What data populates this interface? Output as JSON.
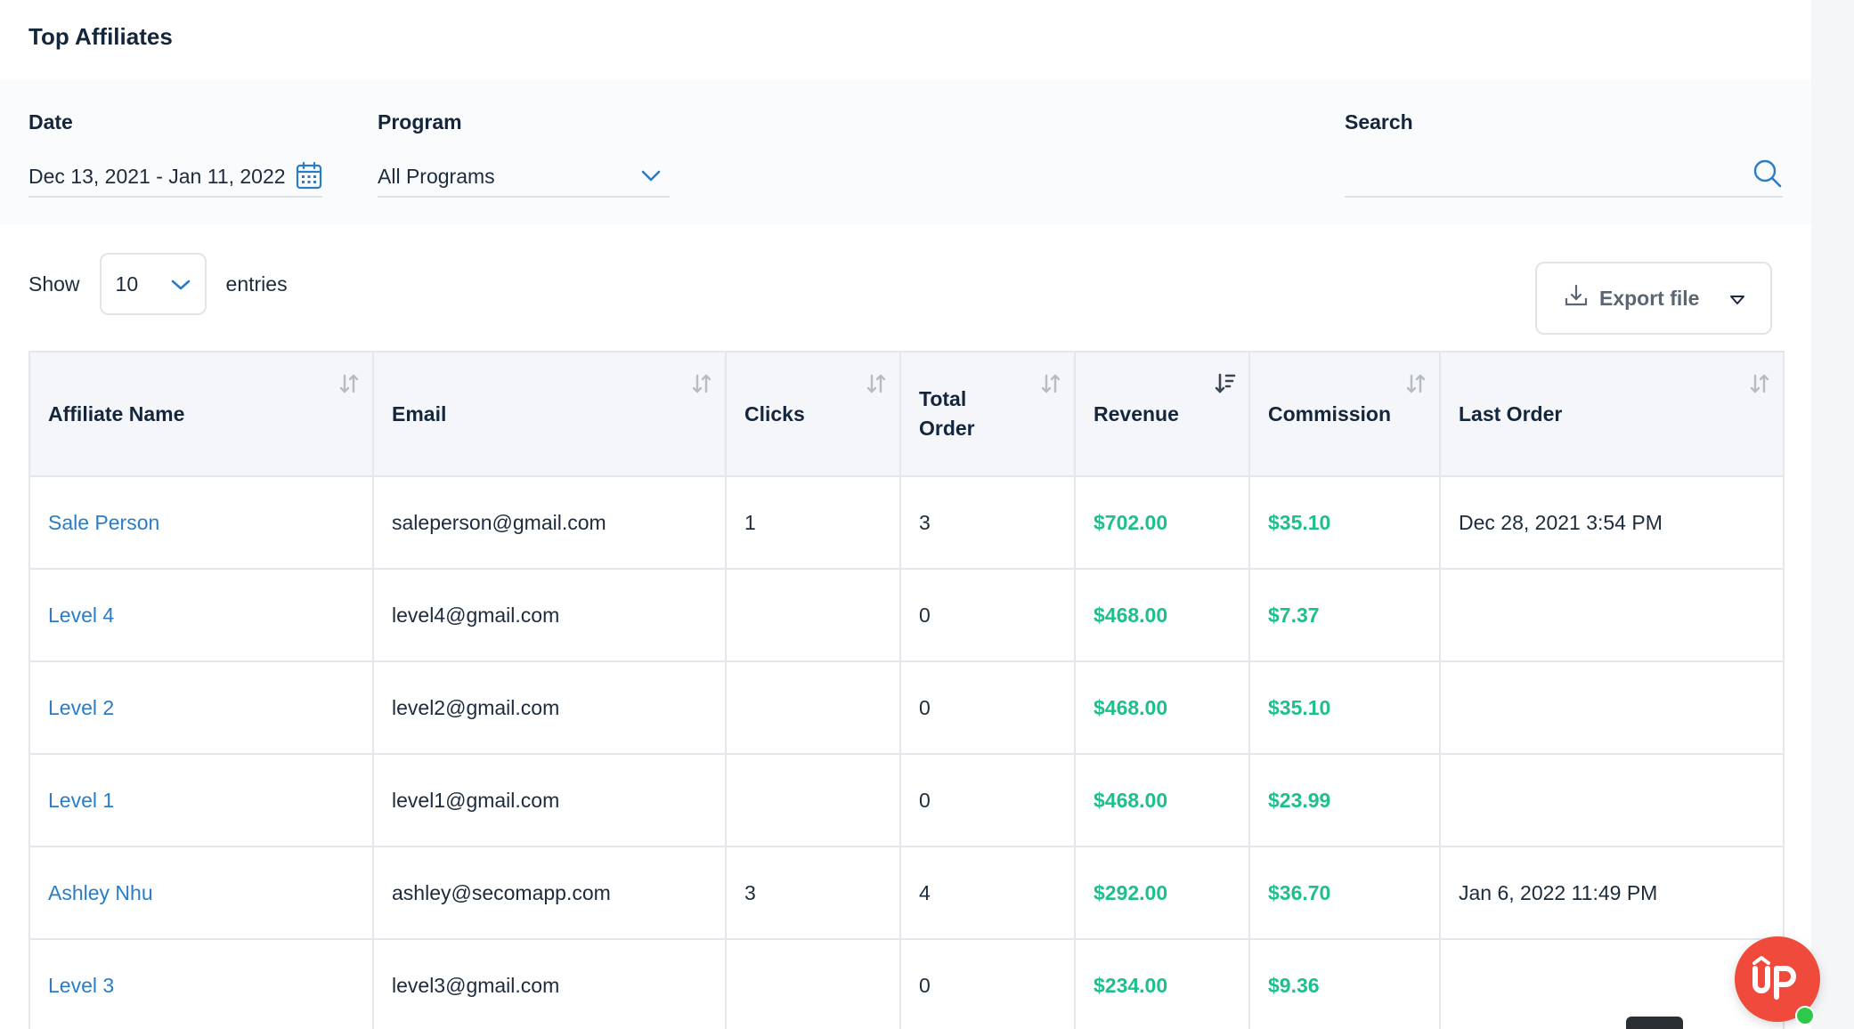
{
  "header": {
    "title": "Top Affiliates"
  },
  "filters": {
    "date_label": "Date",
    "date_value": "Dec 13, 2021 - Jan 11, 2022",
    "program_label": "Program",
    "program_value": "All Programs",
    "search_label": "Search",
    "search_value": ""
  },
  "entries": {
    "show_label": "Show",
    "value": "10",
    "suffix": "entries"
  },
  "export": {
    "label": "Export file"
  },
  "table": {
    "columns": [
      "Affiliate Name",
      "Email",
      "Clicks",
      "Total Order",
      "Revenue",
      "Commission",
      "Last Order"
    ],
    "rows": [
      {
        "name": "Sale Person",
        "email": "saleperson@gmail.com",
        "clicks": "1",
        "total_order": "3",
        "revenue": "$702.00",
        "commission": "$35.10",
        "last_order": "Dec 28, 2021 3:54 PM"
      },
      {
        "name": "Level 4",
        "email": "level4@gmail.com",
        "clicks": "",
        "total_order": "0",
        "revenue": "$468.00",
        "commission": "$7.37",
        "last_order": ""
      },
      {
        "name": "Level 2",
        "email": "level2@gmail.com",
        "clicks": "",
        "total_order": "0",
        "revenue": "$468.00",
        "commission": "$35.10",
        "last_order": ""
      },
      {
        "name": "Level 1",
        "email": "level1@gmail.com",
        "clicks": "",
        "total_order": "0",
        "revenue": "$468.00",
        "commission": "$23.99",
        "last_order": ""
      },
      {
        "name": "Ashley Nhu",
        "email": "ashley@secomapp.com",
        "clicks": "3",
        "total_order": "4",
        "revenue": "$292.00",
        "commission": "$36.70",
        "last_order": "Jan 6, 2022 11:49 PM"
      },
      {
        "name": "Level 3",
        "email": "level3@gmail.com",
        "clicks": "",
        "total_order": "0",
        "revenue": "$234.00",
        "commission": "$9.36",
        "last_order": ""
      }
    ]
  },
  "badge": {
    "label": "UP"
  },
  "colors": {
    "link": "#2a7dc5",
    "money": "#1dbf8f",
    "title": "#14263b",
    "badge": "#ef4a3c",
    "online": "#2ec84a"
  },
  "icons": [
    "calendar-icon",
    "chevron-down-icon",
    "search-icon",
    "download-icon",
    "caret-down-icon",
    "sort-icon",
    "sort-desc-icon"
  ]
}
